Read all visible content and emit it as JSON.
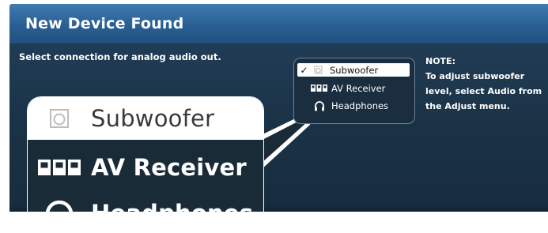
{
  "dialog": {
    "title": "New Device Found",
    "instruction": "Select connection for analog audio out."
  },
  "menu": {
    "items": [
      {
        "label": "Subwoofer",
        "icon": "subwoofer-icon",
        "selected": true
      },
      {
        "label": "AV Receiver",
        "icon": "av-receiver-icon",
        "selected": false
      },
      {
        "label": "Headphones",
        "icon": "headphones-icon",
        "selected": false
      }
    ],
    "selected_mark": "✓"
  },
  "note": {
    "heading": "NOTE:",
    "text": "To adjust subwoofer level, select Audio from the Adjust menu."
  },
  "colors": {
    "title_bar": "#2a5f93",
    "panel": "#1b3347",
    "menu_selected_bg": "#ffffff",
    "text": "#ffffff"
  }
}
